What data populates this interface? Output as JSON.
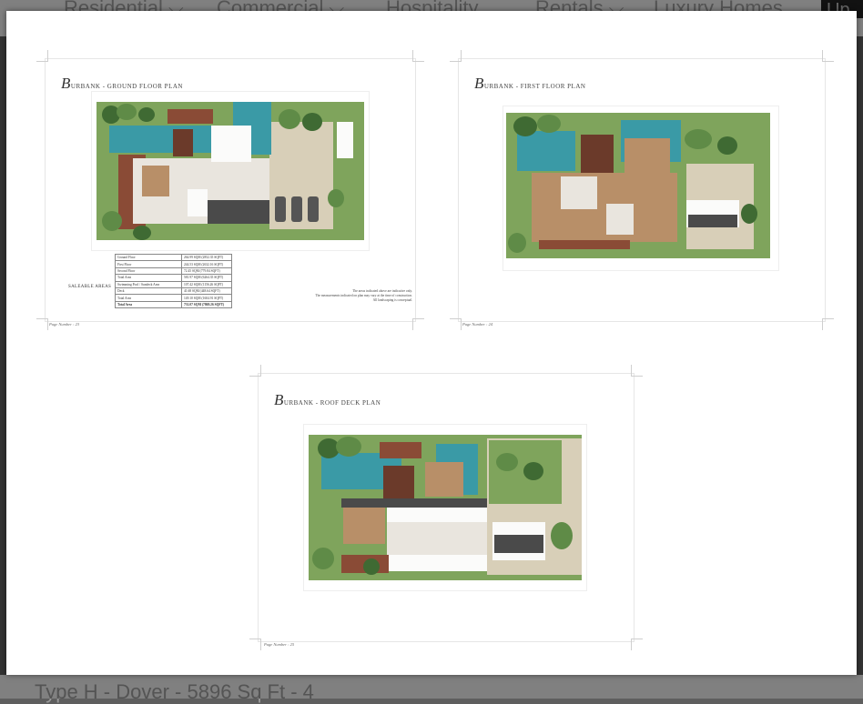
{
  "background": {
    "nav_items": [
      {
        "label": "Residential ⌵",
        "icon": "chevron-down-icon"
      },
      {
        "label": "Commercial ⌵",
        "icon": "chevron-down-icon"
      },
      {
        "label": "Hospitality",
        "icon": ""
      },
      {
        "label": "Rentals ⌵",
        "icon": "chevron-down-icon"
      },
      {
        "label": "Luxury Homes",
        "icon": ""
      }
    ],
    "nav_cut_label": "Up",
    "bottom_text": "Type H - Dover - 5896 Sq Ft - 4"
  },
  "pages": {
    "ground": {
      "title_initial": "B",
      "title_rest": "URBANK - GROUND FLOOR PLAN",
      "page_number": "Page Number : 23",
      "saleable_label": "SALEABLE AREAS",
      "areas": [
        {
          "name": "Ground Floor",
          "value": "264.99 SQM (2852.35 SQFT)"
        },
        {
          "name": "First Floor",
          "value": "244.53 SQM (2632.16 SQFT)"
        },
        {
          "name": "Second Floor",
          "value": "72.45 SQM (779.84 SQFT)"
        },
        {
          "name": "Total Area",
          "value": "581.97 SQM (6264.35 SQFT)"
        },
        {
          "name": "Swimming Pool / Sundeck Area",
          "value": "107.42 SQM (1156.26 SQFT)"
        },
        {
          "name": "Deck",
          "value": "41.68 SQM (448.64 SQFT)"
        },
        {
          "name": "Total Area",
          "value": "149.10 SQM (1604.91 SQFT)"
        },
        {
          "name": "Total Area",
          "value": "731.07 SQM (7869.26 SQFT)"
        }
      ],
      "notes": [
        "The areas indicated above are indicative only.",
        "The measurements indicated on plan may vary at the time of construction.",
        "All landscaping is conceptual."
      ]
    },
    "first": {
      "title_initial": "B",
      "title_rest": "URBANK - FIRST FLOOR PLAN",
      "page_number": "Page Number : 24"
    },
    "roof": {
      "title_initial": "B",
      "title_rest": "URBANK - ROOF DECK PLAN",
      "page_number": "Page Number : 25"
    }
  },
  "colors": {
    "pool": "#3a9aa6",
    "lawn": "#7fa45c",
    "deck": "#8a4b36",
    "tree": "#5f8b47"
  }
}
